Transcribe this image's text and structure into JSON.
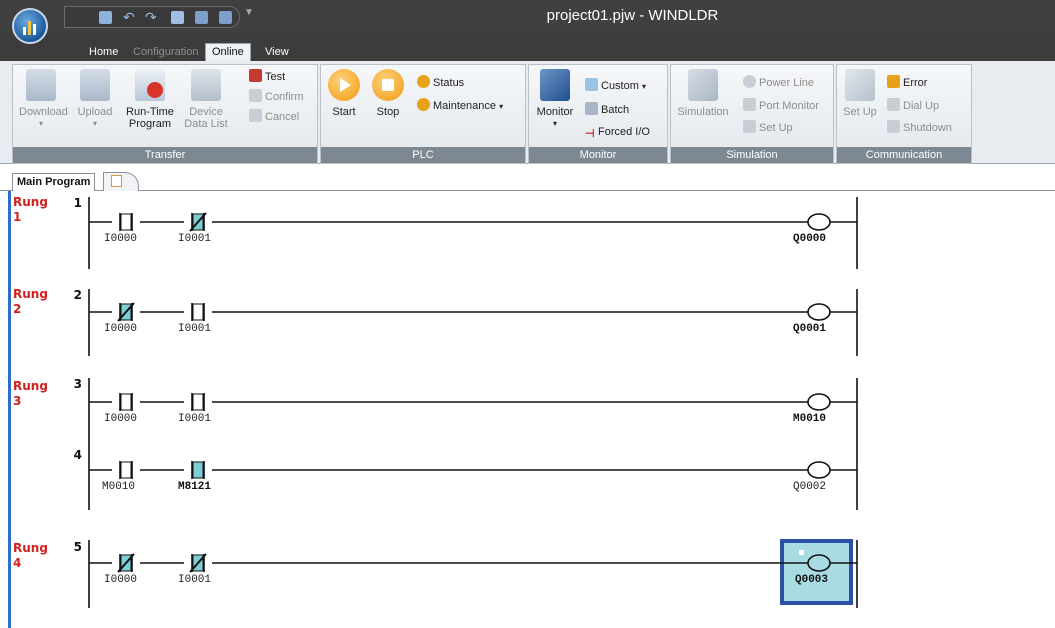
{
  "window": {
    "title": "project01.pjw - WINDLDR"
  },
  "tabs": [
    {
      "label": "Home",
      "state": "normal"
    },
    {
      "label": "Configuration",
      "state": "disabled"
    },
    {
      "label": "Online",
      "state": "active"
    },
    {
      "label": "View",
      "state": "normal"
    }
  ],
  "ribbon": {
    "transfer": {
      "label": "Transfer",
      "download": "Download",
      "upload": "Upload",
      "runtime_line1": "Run-Time",
      "runtime_line2": "Program",
      "device_line1": "Device",
      "device_line2": "Data List",
      "test": "Test",
      "confirm": "Confirm",
      "cancel": "Cancel"
    },
    "plc": {
      "label": "PLC",
      "start": "Start",
      "stop": "Stop",
      "status": "Status",
      "maintenance": "Maintenance"
    },
    "monitor": {
      "label": "Monitor",
      "monitor": "Monitor",
      "custom": "Custom",
      "batch": "Batch",
      "forced_io": "Forced I/O"
    },
    "simulation": {
      "label": "Simulation",
      "simulation": "Simulation",
      "power_line": "Power Line",
      "port_monitor": "Port Monitor",
      "set_up": "Set Up"
    },
    "communication": {
      "label": "Communication",
      "set_up": "Set Up",
      "error": "Error",
      "dial_up": "Dial Up",
      "shutdown": "Shutdown"
    }
  },
  "doc_tabs": {
    "main": "Main Program"
  },
  "rung_word": "Rung",
  "rungs": [
    {
      "number": "1"
    },
    {
      "number": "2"
    },
    {
      "number": "3"
    },
    {
      "number": "4"
    }
  ],
  "lines": [
    {
      "number": "1",
      "c1": "I0000",
      "c2": "I0001",
      "coil": "Q0000"
    },
    {
      "number": "2",
      "c1": "I0000",
      "c2": "I0001",
      "coil": "Q0001"
    },
    {
      "number": "3",
      "c1": "I0000",
      "c2": "I0001",
      "coil": "M0010"
    },
    {
      "number": "4",
      "c1": "M0010",
      "c2": "M8121",
      "coil": "Q0002"
    },
    {
      "number": "5",
      "c1": "I0000",
      "c2": "I0001",
      "coil": "Q0003"
    }
  ],
  "colors": {
    "accent": "#2b6fc7",
    "rung_label": "#d0211d",
    "selection": "#2c4fa8",
    "selection_fill": "#a9dce2",
    "active_contact": "#7ccfd6"
  },
  "icons": {
    "orb": "windldr-logo-icon",
    "qat": [
      "save-icon",
      "undo-icon",
      "redo-icon",
      "grid-icon",
      "download-icon",
      "upload-icon"
    ]
  }
}
